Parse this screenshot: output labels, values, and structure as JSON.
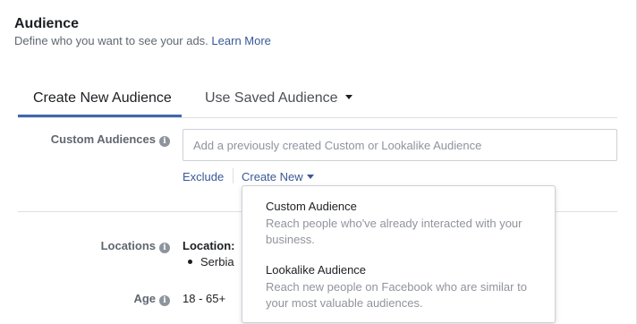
{
  "header": {
    "title": "Audience",
    "subtitle": "Define who you want to see your ads.",
    "learn_more": "Learn More"
  },
  "tabs": [
    {
      "label": "Create New Audience",
      "active": true
    },
    {
      "label": "Use Saved Audience",
      "active": false
    }
  ],
  "custom_audiences": {
    "label": "Custom Audiences",
    "placeholder": "Add a previously created Custom or Lookalike Audience",
    "exclude_label": "Exclude",
    "create_new_label": "Create New"
  },
  "locations": {
    "label": "Locations",
    "heading": "Location:",
    "items": [
      "Serbia"
    ]
  },
  "age": {
    "label": "Age",
    "value": "18 - 65+"
  },
  "dropdown": {
    "options": [
      {
        "title": "Custom Audience",
        "description": "Reach people who've already interacted with your business."
      },
      {
        "title": "Lookalike Audience",
        "description": "Reach new people on Facebook who are similar to your most valuable audiences."
      }
    ]
  },
  "colors": {
    "link": "#385898",
    "tab_underline": "#4267b2",
    "info_icon": "#8d949e"
  },
  "icons": {
    "info": "info-icon",
    "caret": "caret-down-icon"
  }
}
